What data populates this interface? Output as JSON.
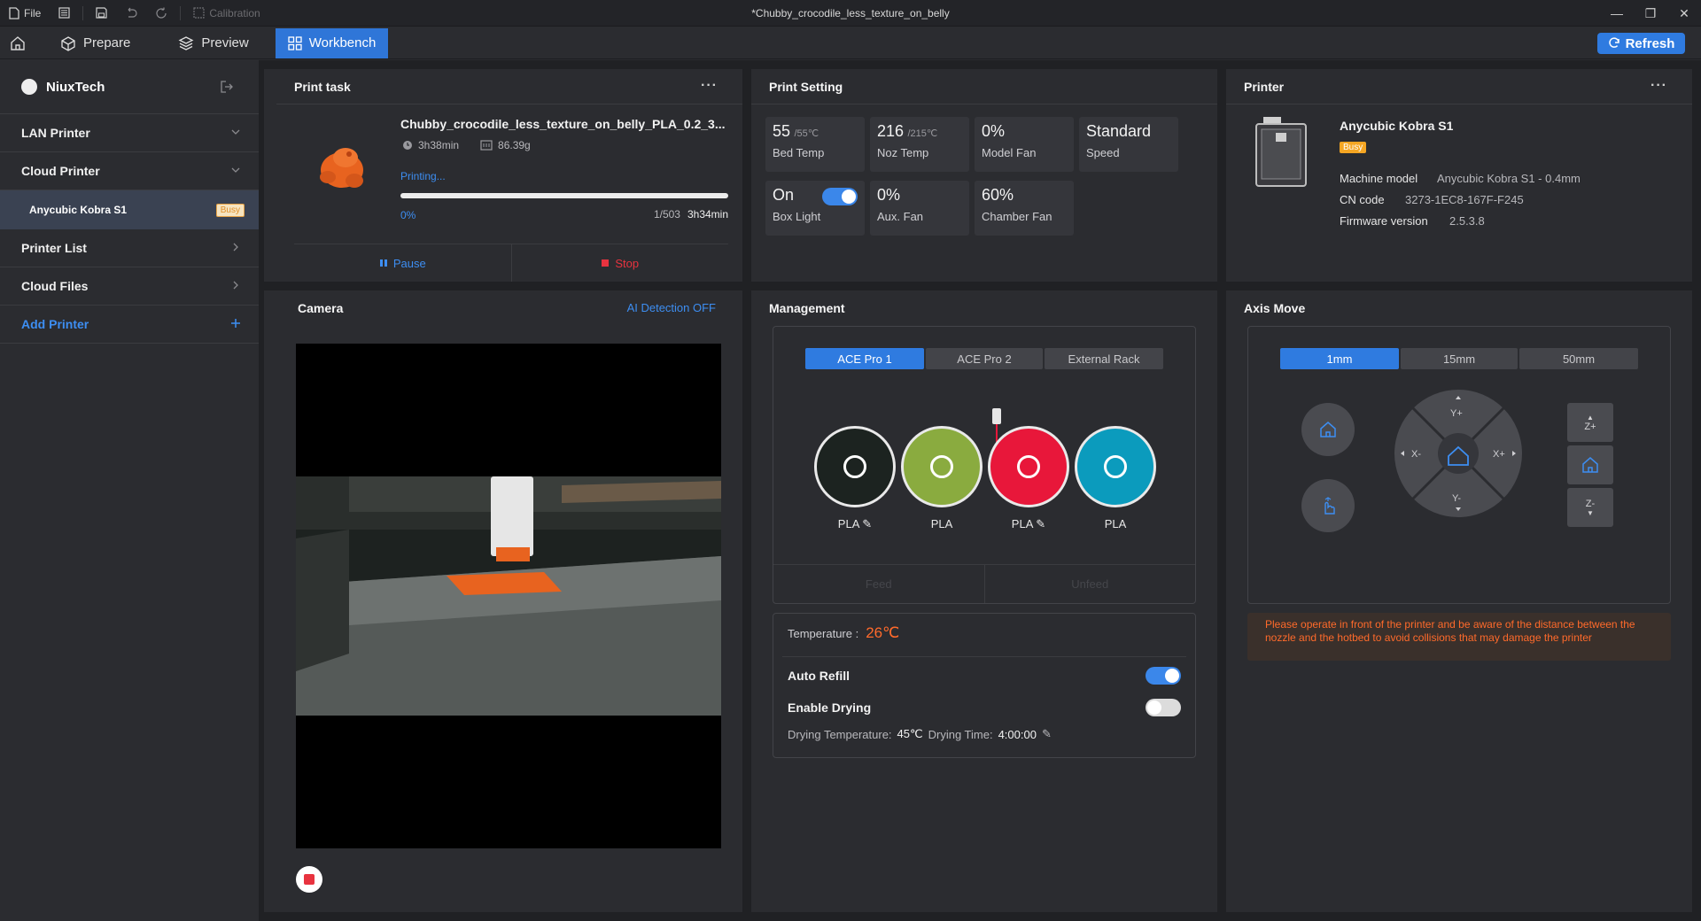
{
  "titlebar": {
    "file_label": "File",
    "calibration_label": "Calibration",
    "window_title": "*Chubby_crocodile_less_texture_on_belly"
  },
  "nav": {
    "tabs": [
      {
        "label": "Prepare"
      },
      {
        "label": "Preview"
      },
      {
        "label": "Workbench"
      }
    ],
    "refresh_label": "Refresh"
  },
  "sidebar": {
    "user_name": "NiuxTech",
    "lan_printer": "LAN Printer",
    "cloud_printer": "Cloud Printer",
    "cloud_printer_item": "Anycubic Kobra S1",
    "cloud_printer_badge": "Busy",
    "printer_list": "Printer List",
    "cloud_files": "Cloud Files",
    "add_printer": "Add Printer"
  },
  "print_task": {
    "title": "Print task",
    "file_name": "Chubby_crocodile_less_texture_on_belly_PLA_0.2_3...",
    "time": "3h38min",
    "weight": "86.39g",
    "status": "Printing...",
    "progress_fraction": 0.0,
    "progress_percent": "0%",
    "layers": "1/503",
    "remaining": "3h34min",
    "pause_label": "Pause",
    "stop_label": "Stop"
  },
  "print_setting": {
    "title": "Print Setting",
    "bed_temp_value": "55",
    "bed_temp_target": "/55℃",
    "bed_temp_label": "Bed Temp",
    "noz_temp_value": "216",
    "noz_temp_target": "/215℃",
    "noz_temp_label": "Noz Temp",
    "model_fan_value": "0%",
    "model_fan_label": "Model Fan",
    "speed_value": "Standard",
    "speed_label": "Speed",
    "box_light_value": "On",
    "box_light_label": "Box Light",
    "aux_fan_value": "0%",
    "aux_fan_label": "Aux. Fan",
    "chamber_fan_value": "60%",
    "chamber_fan_label": "Chamber Fan"
  },
  "printer": {
    "title": "Printer",
    "name": "Anycubic Kobra S1",
    "badge": "Busy",
    "machine_model_label": "Machine model",
    "machine_model_value": "Anycubic Kobra S1 - 0.4mm",
    "cn_code_label": "CN code",
    "cn_code_value": "3273-1EC8-167F-F245",
    "firmware_label": "Firmware version",
    "firmware_value": "2.5.3.8"
  },
  "camera": {
    "title": "Camera",
    "ai_detection": "AI Detection OFF"
  },
  "management": {
    "title": "Management",
    "tabs": [
      "ACE Pro 1",
      "ACE Pro 2",
      "External Rack"
    ],
    "spools": [
      {
        "label": "PLA",
        "color": "#1c2320",
        "editable": true
      },
      {
        "label": "PLA",
        "color": "#8aab3f",
        "editable": false
      },
      {
        "label": "PLA",
        "color": "#e8173a",
        "editable": true
      },
      {
        "label": "PLA",
        "color": "#0b9bbd",
        "editable": false
      }
    ],
    "feed_label": "Feed",
    "unfeed_label": "Unfeed",
    "temperature_label": "Temperature :",
    "temperature_value": "26℃",
    "auto_refill_label": "Auto Refill",
    "enable_drying_label": "Enable Drying",
    "drying_temp_label": "Drying Temperature:",
    "drying_temp_value": "45℃",
    "drying_time_label": "Drying Time:",
    "drying_time_value": "4:00:00"
  },
  "axis_move": {
    "title": "Axis Move",
    "steps": [
      "1mm",
      "15mm",
      "50mm"
    ],
    "y_plus": "Y+",
    "y_minus": "Y-",
    "x_plus": "X+",
    "x_minus": "X-",
    "z_plus": "Z+",
    "z_minus": "Z-",
    "warning": "Please operate in front of the printer and be aware of the distance between the nozzle and the hotbed to avoid collisions that may damage the printer"
  },
  "colors": {
    "accent": "#2f7be0",
    "busy": "#f5a623",
    "warning": "#ff6a2b",
    "stop": "#e8333f"
  }
}
